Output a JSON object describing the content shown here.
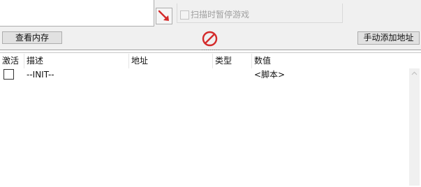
{
  "options": {
    "pause_label": "扫描时暂停游戏"
  },
  "toolbar": {
    "view_memory_label": "查看内存",
    "add_address_label": "手动添加地址"
  },
  "table": {
    "columns": [
      "激活",
      "描述",
      "地址",
      "类型",
      "数值"
    ],
    "rows": [
      {
        "active": false,
        "description": "--INIT--",
        "address": "",
        "type": "",
        "value": "<脚本>"
      }
    ]
  },
  "icons": {
    "pointer": "red-arrow-icon",
    "clear": "no-entry-icon",
    "scroll_up": "chevron-up-icon"
  },
  "colors": {
    "icon_red": "#d42a2a",
    "toolbar_bg": "#f0f0f0",
    "disabled_text": "#a0a0a0"
  }
}
